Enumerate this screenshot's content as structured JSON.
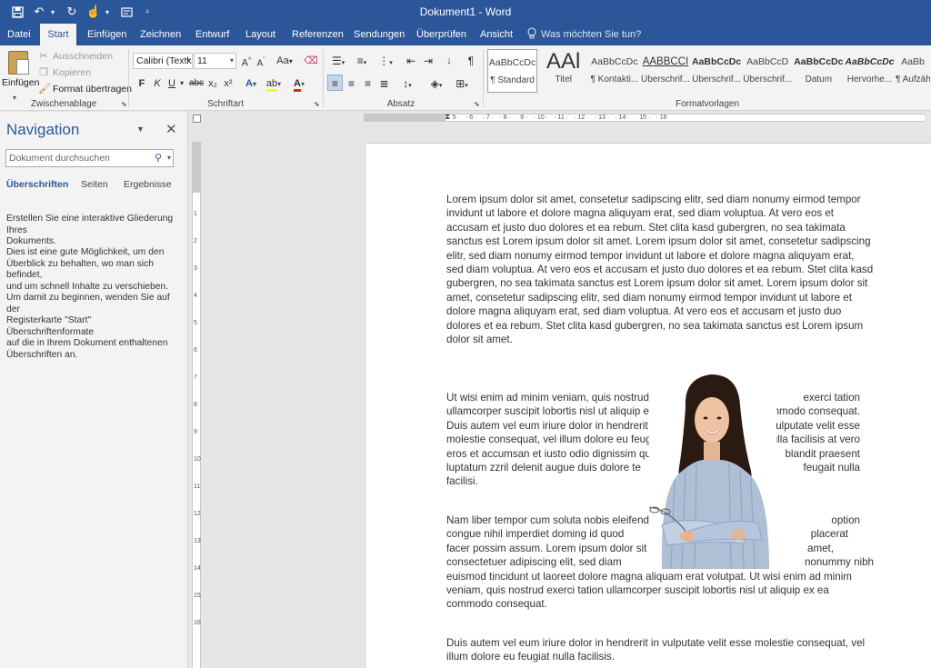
{
  "app": {
    "window_title": "Dokument1",
    "app_name": "Word",
    "title_sep": " - "
  },
  "tabs": [
    "Datei",
    "Start",
    "Einfügen",
    "Zeichnen",
    "Entwurf",
    "Layout",
    "Referenzen",
    "Sendungen",
    "Überprüfen",
    "Ansicht"
  ],
  "active_tab": "Start",
  "tell_me": "Was möchten Sie tun?",
  "ribbon": {
    "clipboard": {
      "label": "Zwischenablage",
      "paste": "Einfügen",
      "cut": "Ausschneiden",
      "copy": "Kopieren",
      "format_painter": "Format übertragen"
    },
    "font": {
      "label": "Schriftart",
      "family": "Calibri (Textk",
      "size": "11",
      "grow": "A",
      "shrink": "A",
      "case": "Aa",
      "bold": "F",
      "italic": "K",
      "underline": "U",
      "strike": "abc",
      "subscript": "x₂",
      "superscript": "x²",
      "font_color": "A"
    },
    "paragraph": {
      "label": "Absatz"
    },
    "styles": {
      "label": "Formatvorlagen",
      "items": [
        {
          "sample": "AaBbCcDc",
          "name": "¶ Standard"
        },
        {
          "sample": "AAl",
          "name": "Titel"
        },
        {
          "sample": "AaBbCcDc",
          "name": "¶ Kontakti..."
        },
        {
          "sample": "AABBCCI",
          "name": "Überschrif..."
        },
        {
          "sample": "AaBbCcDc",
          "name": "Überschrif..."
        },
        {
          "sample": "AaBbCcD",
          "name": "Überschrif..."
        },
        {
          "sample": "AaBbCcDc",
          "name": "Datum"
        },
        {
          "sample": "AaBbCcDc",
          "name": "Hervorhe..."
        },
        {
          "sample": "AaBb",
          "name": "¶ Aufzäh"
        }
      ]
    }
  },
  "navigation": {
    "title": "Navigation",
    "search_placeholder": "Dokument durchsuchen",
    "tabs": [
      "Überschriften",
      "Seiten",
      "Ergebnisse"
    ],
    "help1_lines": [
      "Erstellen Sie eine interaktive Gliederung Ihres",
      "Dokuments."
    ],
    "help2_lines": [
      "Dies ist eine gute Möglichkeit, um den",
      "Überblick zu behalten, wo man sich befindet,",
      "und um schnell Inhalte zu verschieben."
    ],
    "help3_lines": [
      "Um damit zu beginnen, wenden Sie auf der",
      "Registerkarte \"Start\" Überschriftenformate",
      "auf die in Ihrem Dokument enthaltenen",
      "Überschriften an."
    ]
  },
  "ruler": {
    "horizontal": "· 1 · ˙ · 1 · ˙ · 2 · ˙ · 3 · ˙ · 4 · ˙ · 5 · ˙ · 6 · ˙ · 7 · ˙ · 8 · ˙ · 9 · ˙ · 10 · ˙ · 11 · ˙ · 12 · ˙ · 13 · ˙ · 14 · ˙ · 15 · ˙ · 16",
    "vertical": [
      "1",
      "2",
      "3",
      "4",
      "5",
      "6",
      "7",
      "8",
      "9",
      "10",
      "11",
      "12",
      "13",
      "14",
      "15",
      "16"
    ]
  },
  "document": {
    "p1": [
      "Lorem ipsum dolor sit amet, consetetur sadipscing elitr, sed diam nonumy eirmod tempor",
      "invidunt ut labore et dolore magna aliquyam erat, sed diam voluptua. At vero eos et",
      "accusam et justo duo dolores et ea rebum. Stet clita kasd gubergren, no sea takimata",
      "sanctus est Lorem ipsum dolor sit amet. Lorem ipsum dolor sit amet, consetetur sadipscing",
      "elitr, sed diam nonumy eirmod tempor invidunt ut labore et dolore magna aliquyam erat,",
      "sed diam voluptua. At vero eos et accusam et justo duo dolores et ea rebum. Stet clita kasd",
      "gubergren, no sea takimata sanctus est Lorem ipsum dolor sit amet. Lorem ipsum dolor sit",
      "amet, consetetur sadipscing elitr, sed diam nonumy eirmod tempor invidunt ut labore et",
      "dolore magna aliquyam erat, sed diam voluptua. At vero eos et accusam et justo duo",
      "dolores et ea rebum. Stet clita kasd gubergren, no sea takimata sanctus est Lorem ipsum",
      "dolor sit amet."
    ],
    "p2": [
      [
        "Ut wisi enim ad minim veniam, quis nostrud",
        "exerci tation"
      ],
      [
        "ullamcorper suscipit lobortis nisl ut aliquip ex ea",
        "commodo consequat."
      ],
      [
        "Duis autem vel eum iriure dolor in hendrerit in",
        "vulputate velit esse"
      ],
      [
        "molestie consequat, vel illum dolore eu feugiat",
        "nulla facilisis at vero"
      ],
      [
        "eros et accumsan et iusto odio dignissim qui",
        "blandit praesent"
      ],
      [
        "luptatum zzril delenit augue duis dolore te",
        "feugait nulla"
      ],
      [
        "facilisi.",
        ""
      ]
    ],
    "p3": [
      [
        "Nam liber tempor cum soluta nobis eleifend",
        "option"
      ],
      [
        "congue nihil imperdiet doming id quod",
        "placerat"
      ],
      [
        "facer possim assum. Lorem ipsum dolor sit",
        "amet,"
      ],
      [
        "consectetuer adipiscing elit, sed diam",
        "nonummy nibh"
      ]
    ],
    "p3_rest": [
      "euismod tincidunt ut laoreet dolore magna aliquam erat volutpat. Ut wisi enim ad minim",
      "veniam, quis nostrud exerci tation ullamcorper suscipit lobortis nisl ut aliquip ex ea",
      "commodo consequat."
    ],
    "p4": [
      "Duis autem vel eum iriure dolor in hendrerit in vulputate velit esse molestie consequat, vel",
      "illum dolore eu feugiat nulla facilisis."
    ]
  },
  "colors": {
    "accent": "#2b579a",
    "ribbon_bg": "#f3f3f3",
    "workspace": "#e6e6e6"
  }
}
